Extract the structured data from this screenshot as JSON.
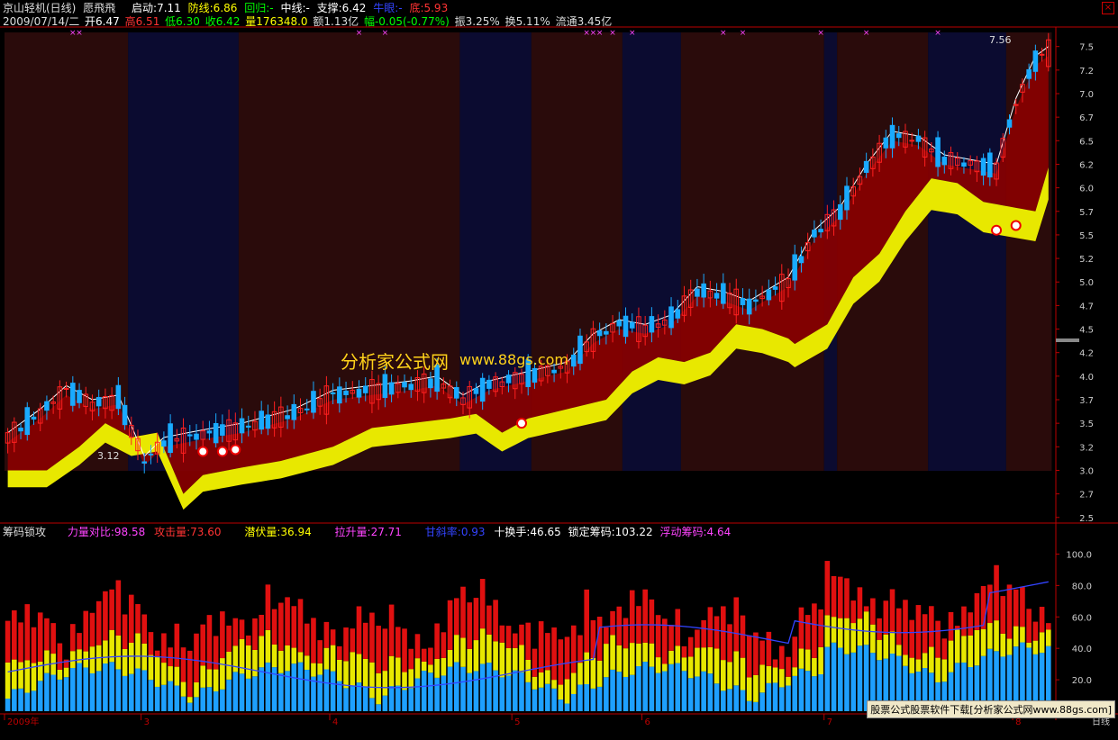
{
  "header1": {
    "stock": "京山轻机(日线)",
    "indicator": "愿飛飛",
    "start": "启动:7.11",
    "defense": "防线:6.86",
    "pullback": "回归:-",
    "midline": "中线:-",
    "support": "支撑:6.42",
    "cow": "牛眼:-",
    "bottom": "底:5.93"
  },
  "header2": {
    "date": "2009/07/14/二",
    "open": "开6.47",
    "high": "高6.51",
    "low": "低6.30",
    "close": "收6.42",
    "volume": "量176348.0",
    "amount": "额1.13亿",
    "change": "幅-0.05(-0.77%)",
    "amplitude": "振3.25%",
    "turnover": "换5.11%",
    "float": "流通3.45亿"
  },
  "sub_header": {
    "name": "筹码锁攻",
    "power": "力量对比:98.58",
    "attack": "攻击量:73.60",
    "hidden": "潜伏量:36.94",
    "lift": "拉升量:27.71",
    "slope": "甘斜率:0.93",
    "turnover10": "十换手:46.65",
    "locked": "锁定筹码:103.22",
    "floating": "浮动筹码:4.64"
  },
  "watermark": {
    "text": "分析家公式网",
    "url": "www.88gs.com"
  },
  "footer": {
    "text": "股票公式股票软件下载[分析家公式网www.88gs.com]"
  },
  "labels": {
    "peak": "7.56",
    "trough": "3.12",
    "year": "2009年",
    "bottom_right": "日线"
  },
  "colors": {
    "up": "#ff2020",
    "down": "#19aaff",
    "fill_red": "#8b0000",
    "fill_yellow": "#e8e800",
    "bg_red": "#2a0b0b",
    "bg_blue": "#0b0b30"
  },
  "chart_data": [
    {
      "type": "candlestick",
      "y_ticks": [
        2.5,
        2.75,
        3.0,
        3.25,
        3.5,
        3.75,
        4.0,
        4.25,
        4.5,
        4.75,
        5.0,
        5.25,
        5.5,
        5.75,
        6.0,
        6.25,
        6.5,
        6.75,
        7.0,
        7.25,
        7.5
      ],
      "y_tick_labels": [
        "2.5",
        "2.7",
        "3.0",
        "3.2",
        "3.5",
        "3.7",
        "4.0",
        "4.2",
        "4.5",
        "4.7",
        "5.0",
        "5.2",
        "5.5",
        "5.7",
        "6.0",
        "6.2",
        "6.5",
        "6.7",
        "7.0",
        "7.2",
        "7.5"
      ],
      "ylim": [
        2.45,
        7.65
      ],
      "x_labels": [
        {
          "index": 0,
          "label": "2009年"
        },
        {
          "index": 21,
          "label": "3"
        },
        {
          "index": 50,
          "label": "4"
        },
        {
          "index": 78,
          "label": "5"
        },
        {
          "index": 98,
          "label": "6"
        },
        {
          "index": 126,
          "label": "7"
        },
        {
          "index": 155,
          "label": "8"
        }
      ],
      "background_zones": [
        {
          "from": 0,
          "to": 18,
          "kind": "red"
        },
        {
          "from": 19,
          "to": 35,
          "kind": "blue"
        },
        {
          "from": 36,
          "to": 69,
          "kind": "red"
        },
        {
          "from": 70,
          "to": 80,
          "kind": "blue"
        },
        {
          "from": 81,
          "to": 94,
          "kind": "red"
        },
        {
          "from": 95,
          "to": 103,
          "kind": "blue"
        },
        {
          "from": 104,
          "to": 125,
          "kind": "red"
        },
        {
          "from": 126,
          "to": 127,
          "kind": "blue"
        },
        {
          "from": 128,
          "to": 141,
          "kind": "red"
        },
        {
          "from": 142,
          "to": 153,
          "kind": "blue"
        },
        {
          "from": 154,
          "to": 160,
          "kind": "red"
        }
      ],
      "x_markers": [
        10,
        11,
        54,
        58,
        89,
        90,
        91,
        93,
        96,
        110,
        113,
        125,
        132,
        143
      ]
    },
    {
      "type": "bar",
      "name": "筹码锁攻",
      "y_ticks": [
        20,
        40,
        60,
        80,
        100
      ],
      "ylim": [
        0,
        110
      ]
    }
  ]
}
